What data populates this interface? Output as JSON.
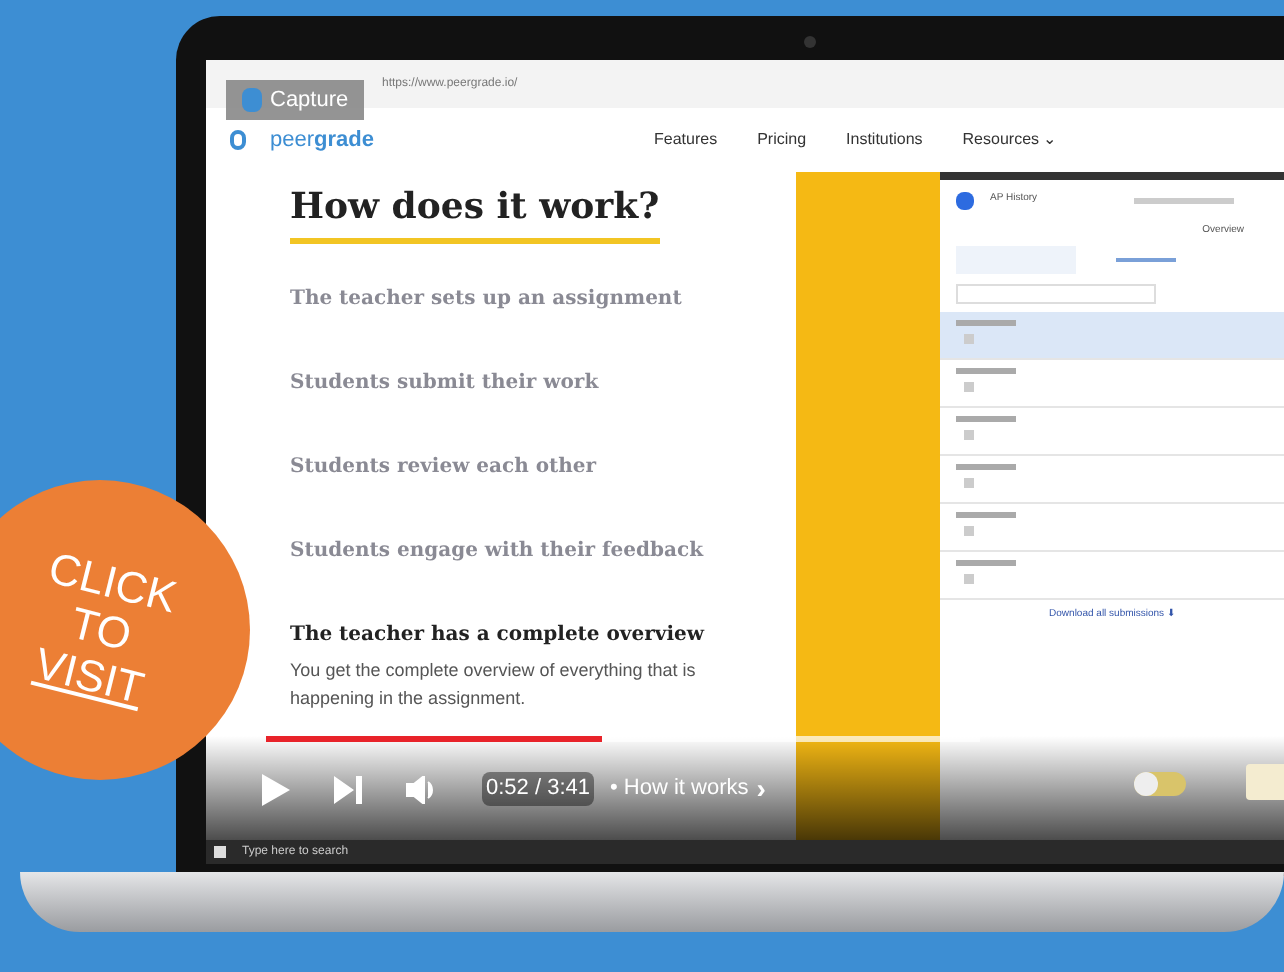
{
  "browser": {
    "url": "https://www.peergrade.io/",
    "capture_label": "Capture"
  },
  "site": {
    "logo": "peer**grade**",
    "nav": [
      {
        "label": "Features"
      },
      {
        "label": "Pricing"
      },
      {
        "label": "Institutions"
      },
      {
        "label": "Resources ⌄"
      }
    ]
  },
  "heading": "How does it work?",
  "steps": [
    {
      "title": "The teacher sets up an assignment",
      "selected": false
    },
    {
      "title": "Students submit their work",
      "selected": false
    },
    {
      "title": "Students review each other",
      "selected": false
    },
    {
      "title": "Students engage with their feedback",
      "selected": false
    },
    {
      "title": "The teacher has a complete overview",
      "selected": true,
      "description": "You get the complete overview of everything that is happening in the assignment."
    }
  ],
  "app": {
    "course": "AP History",
    "tab": "Overview",
    "rows": [
      {
        "selected": true
      },
      {
        "selected": false
      },
      {
        "selected": false
      },
      {
        "selected": false
      },
      {
        "selected": false
      },
      {
        "selected": false
      }
    ],
    "footer": "Download all submissions ⬇"
  },
  "player": {
    "level": 0.47,
    "time": "0:52 / 3:41",
    "chapter": "• How it works",
    "chevron": "›"
  },
  "taskbar": {
    "search_placeholder": "Type here to search"
  },
  "badge": {
    "lines": [
      "CLICK",
      "TO",
      "VISIT"
    ]
  }
}
